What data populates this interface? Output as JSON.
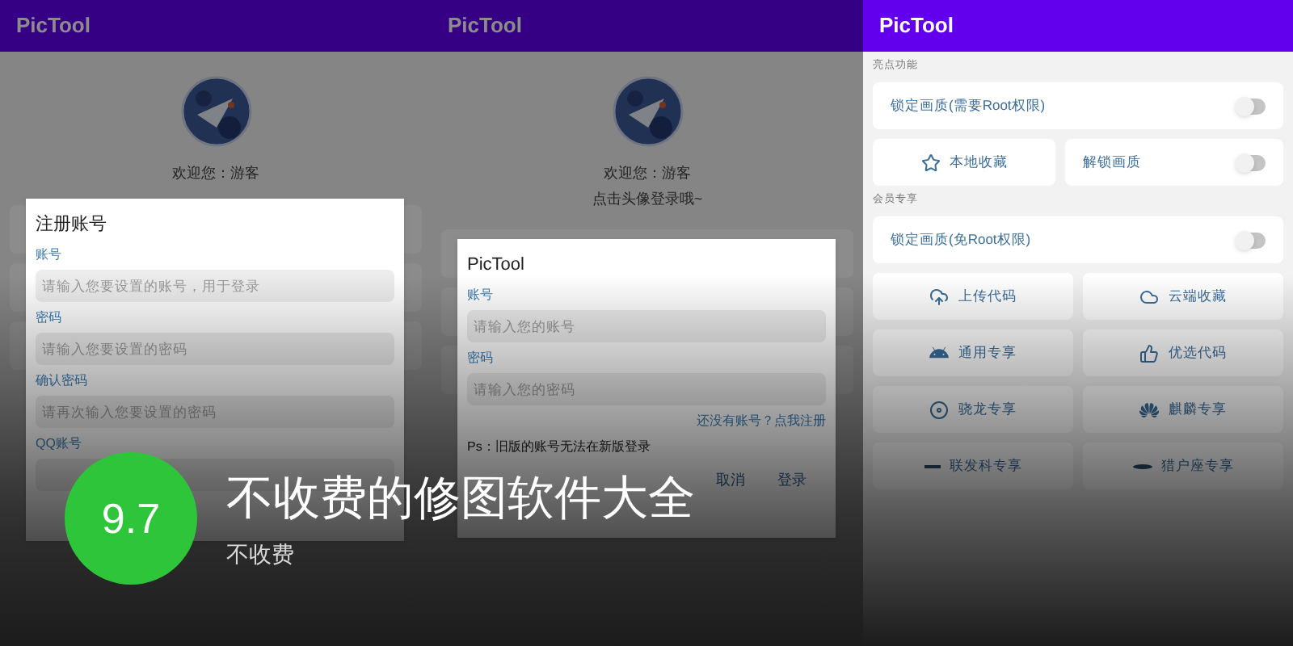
{
  "screens": [
    {
      "kind": "register",
      "app_bar": {
        "title": "PicTool"
      },
      "profile": {
        "greeting": "欢迎您：游客"
      },
      "dialog": {
        "title": "注册账号",
        "fields": [
          {
            "label": "账号",
            "placeholder": "请输入您要设置的账号，用于登录"
          },
          {
            "label": "密码",
            "placeholder": "请输入您要设置的密码"
          },
          {
            "label": "确认密码",
            "placeholder": "请再次输入您要设置的密码"
          },
          {
            "label": "QQ账号"
          }
        ]
      }
    },
    {
      "kind": "login",
      "app_bar": {
        "title": "PicTool"
      },
      "profile": {
        "greeting": "欢迎您：游客",
        "hint": "点击头像登录哦~"
      },
      "dialog": {
        "title": "PicTool",
        "fields": [
          {
            "label": "账号",
            "placeholder": "请输入您的账号"
          },
          {
            "label": "密码",
            "placeholder": "请输入您的密码"
          }
        ],
        "register_link": "还没有账号？点我注册",
        "note": "Ps：旧版的账号无法在新版登录",
        "buttons": [
          "取消",
          "登录"
        ]
      }
    },
    {
      "kind": "menu",
      "app_bar": {
        "title": "PicTool"
      },
      "sections": [
        {
          "title": "亮点功能",
          "rows": [
            [
              {
                "kind": "switch",
                "label": "锁定画质(需要Root权限)",
                "on": false
              }
            ],
            [
              {
                "kind": "button",
                "label": "本地收藏"
              },
              {
                "kind": "switch",
                "label": "解锁画质",
                "on": false
              }
            ]
          ]
        },
        {
          "title": "会员专享",
          "rows": [
            [
              {
                "kind": "switch",
                "label": "锁定画质(免Root权限)",
                "on": false
              }
            ],
            [
              {
                "kind": "button",
                "label": "上传代码"
              },
              {
                "kind": "button",
                "label": "云端收藏"
              }
            ],
            [
              {
                "kind": "button",
                "label": "通用专享"
              },
              {
                "kind": "button",
                "label": "优选代码"
              }
            ],
            [
              {
                "kind": "button",
                "label": "骁龙专享"
              },
              {
                "kind": "button",
                "label": "麒麟专享"
              }
            ],
            [
              {
                "kind": "button",
                "label": "联发科专享"
              },
              {
                "kind": "button",
                "label": "猎户座专享"
              }
            ]
          ]
        }
      ]
    }
  ],
  "overlay": {
    "score": "9.7",
    "title": "不收费的修图软件大全",
    "subtitle": "不收费"
  }
}
